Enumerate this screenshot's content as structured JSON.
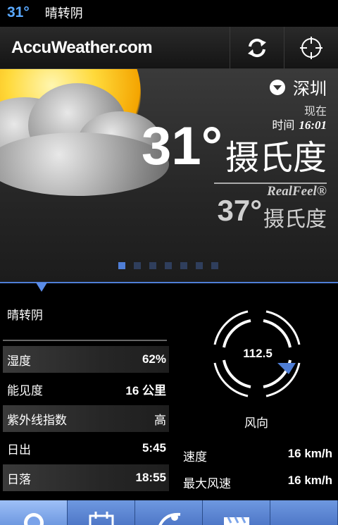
{
  "status_bar": {
    "temp": "31°",
    "condition": "晴转阴"
  },
  "header": {
    "logo": "AccuWeather.com"
  },
  "hero": {
    "city": "深圳",
    "now_label": "现在",
    "time_label": "时间",
    "time_value": "16:01",
    "temp_value": "31°",
    "temp_unit": "摄氏度",
    "realfeel_label": "RealFeel®",
    "realfeel_value": "37°",
    "realfeel_unit": "摄氏度",
    "page_count": 7,
    "active_page": 0
  },
  "conditions": {
    "summary": "晴转阴",
    "rows": [
      {
        "label": "湿度",
        "value": "62%"
      },
      {
        "label": "能见度",
        "value": "16 公里"
      },
      {
        "label": "紫外线指数",
        "value": "高"
      },
      {
        "label": "日出",
        "value": "5:45"
      },
      {
        "label": "日落",
        "value": "18:55"
      }
    ]
  },
  "wind": {
    "direction_value": "112.5",
    "direction_label": "风向",
    "speed_label": "速度",
    "speed_value": "16 km/h",
    "gust_label": "最大风速",
    "gust_value": "16 km/h"
  },
  "colors": {
    "accent": "#4f7ed6",
    "status_temp": "#5aa9ff"
  },
  "bottom_nav": [
    "current-icon",
    "calendar-icon",
    "satellite-icon",
    "video-icon",
    "more-icon"
  ]
}
